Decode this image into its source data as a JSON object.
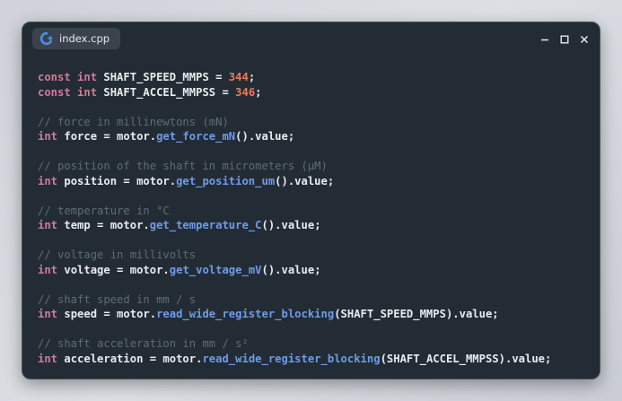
{
  "window": {
    "tab_title": "index.cpp",
    "tab_icon": "cpp-file-icon",
    "controls": [
      "minimize-icon",
      "maximize-icon",
      "close-icon"
    ]
  },
  "colors": {
    "background": "#232c35",
    "keyword": "#d07a9a",
    "number": "#ee7a5a",
    "function": "#6f9be8",
    "comment": "#5f6b77",
    "text": "#e8ebef",
    "tab_icon": "#4a8fe7"
  },
  "code": [
    {
      "blank": false,
      "tokens": [
        [
          "kw",
          "const"
        ],
        [
          "pn",
          " "
        ],
        [
          "kw",
          "int"
        ],
        [
          "id",
          " SHAFT_SPEED_MMPS = "
        ],
        [
          "num",
          "344"
        ],
        [
          "pn",
          ";"
        ]
      ]
    },
    {
      "blank": false,
      "tokens": [
        [
          "kw",
          "const"
        ],
        [
          "pn",
          " "
        ],
        [
          "kw",
          "int"
        ],
        [
          "id",
          " SHAFT_ACCEL_MMPSS = "
        ],
        [
          "num",
          "346"
        ],
        [
          "pn",
          ";"
        ]
      ]
    },
    {
      "blank": true,
      "tokens": []
    },
    {
      "blank": false,
      "tokens": [
        [
          "cm",
          "// force in millinewtons (mN)"
        ]
      ]
    },
    {
      "blank": false,
      "tokens": [
        [
          "kw",
          "int"
        ],
        [
          "id",
          " force = motor."
        ],
        [
          "fn",
          "get_force_mN"
        ],
        [
          "pn",
          "().value;"
        ]
      ]
    },
    {
      "blank": true,
      "tokens": []
    },
    {
      "blank": false,
      "tokens": [
        [
          "cm",
          "// position of the shaft in micrometers (μM)"
        ]
      ]
    },
    {
      "blank": false,
      "tokens": [
        [
          "kw",
          "int"
        ],
        [
          "id",
          " position = motor."
        ],
        [
          "fn",
          "get_position_um"
        ],
        [
          "pn",
          "().value;"
        ]
      ]
    },
    {
      "blank": true,
      "tokens": []
    },
    {
      "blank": false,
      "tokens": [
        [
          "cm",
          "// temperature in °C"
        ]
      ]
    },
    {
      "blank": false,
      "tokens": [
        [
          "kw",
          "int"
        ],
        [
          "id",
          " temp = motor."
        ],
        [
          "fn",
          "get_temperature_C"
        ],
        [
          "pn",
          "().value;"
        ]
      ]
    },
    {
      "blank": true,
      "tokens": []
    },
    {
      "blank": false,
      "tokens": [
        [
          "cm",
          "// voltage in millivolts"
        ]
      ]
    },
    {
      "blank": false,
      "tokens": [
        [
          "kw",
          "int"
        ],
        [
          "id",
          " voltage = motor."
        ],
        [
          "fn",
          "get_voltage_mV"
        ],
        [
          "pn",
          "().value;"
        ]
      ]
    },
    {
      "blank": true,
      "tokens": []
    },
    {
      "blank": false,
      "tokens": [
        [
          "cm",
          "// shaft speed in mm / s"
        ]
      ]
    },
    {
      "blank": false,
      "tokens": [
        [
          "kw",
          "int"
        ],
        [
          "id",
          " speed = motor."
        ],
        [
          "fn",
          "read_wide_register_blocking"
        ],
        [
          "pn",
          "(SHAFT_SPEED_MMPS).value;"
        ]
      ]
    },
    {
      "blank": true,
      "tokens": []
    },
    {
      "blank": false,
      "tokens": [
        [
          "cm",
          "// shaft acceleration in mm / s²"
        ]
      ]
    },
    {
      "blank": false,
      "tokens": [
        [
          "kw",
          "int"
        ],
        [
          "id",
          " acceleration = motor."
        ],
        [
          "fn",
          "read_wide_register_blocking"
        ],
        [
          "pn",
          "(SHAFT_ACCEL_MMPSS).value;"
        ]
      ]
    }
  ]
}
